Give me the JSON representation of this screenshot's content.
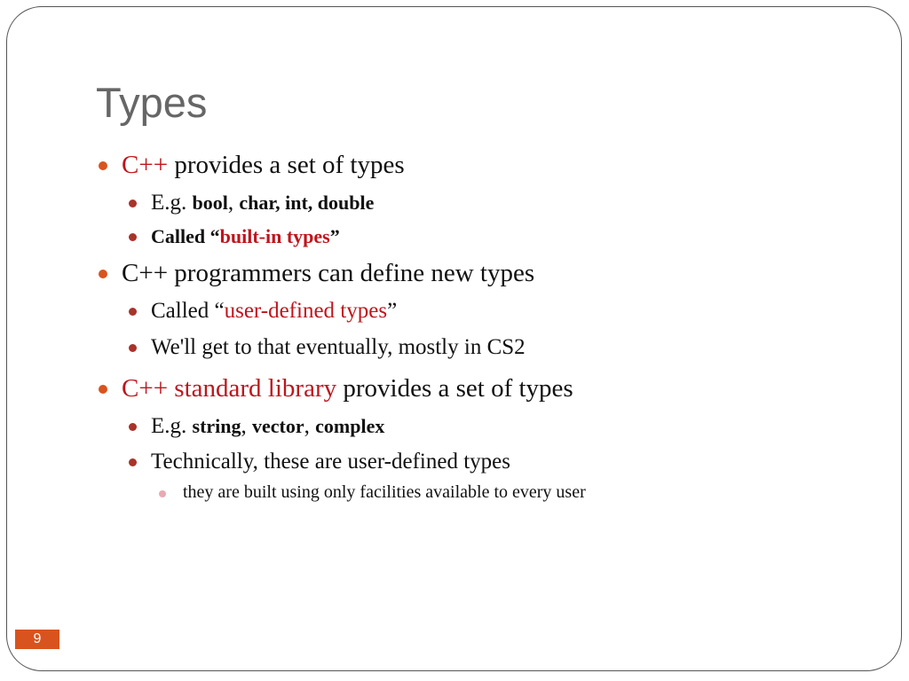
{
  "slide": {
    "title": "Types",
    "page_number": "9",
    "colors": {
      "accent": "#d9531e",
      "highlight": "#c0141c",
      "title": "#666666"
    },
    "bullets": [
      {
        "level": 1,
        "runs": [
          {
            "text": "C++",
            "style": "red"
          },
          {
            "text": " provides a set of types",
            "style": "normal"
          }
        ]
      },
      {
        "level": 2,
        "runs": [
          {
            "text": "E.g. ",
            "style": "normal"
          },
          {
            "text": "bool",
            "style": "bold"
          },
          {
            "text": ", ",
            "style": "normal"
          },
          {
            "text": "char, int, double",
            "style": "bold"
          }
        ]
      },
      {
        "level": 2,
        "runs": [
          {
            "text": "Called “",
            "style": "bold"
          },
          {
            "text": "built-in types",
            "style": "bold-red"
          },
          {
            "text": "”",
            "style": "bold"
          }
        ]
      },
      {
        "level": 1,
        "runs": [
          {
            "text": "C++ programmers can define new types",
            "style": "normal"
          }
        ]
      },
      {
        "level": 2,
        "runs": [
          {
            "text": "Called “",
            "style": "normal"
          },
          {
            "text": "user-defined types",
            "style": "red"
          },
          {
            "text": "”",
            "style": "normal"
          }
        ]
      },
      {
        "level": 2,
        "runs": [
          {
            "text": "We'll get to that eventually, mostly in CS2",
            "style": "normal"
          }
        ]
      },
      {
        "level": 1,
        "runs": [
          {
            "text": "C++ standard library",
            "style": "red"
          },
          {
            "text": " provides a set of types",
            "style": "normal"
          }
        ]
      },
      {
        "level": 2,
        "runs": [
          {
            "text": "E.g. ",
            "style": "normal"
          },
          {
            "text": "string",
            "style": "bold"
          },
          {
            "text": ", ",
            "style": "normal"
          },
          {
            "text": "vector",
            "style": "bold"
          },
          {
            "text": ", ",
            "style": "normal"
          },
          {
            "text": "complex",
            "style": "bold"
          }
        ]
      },
      {
        "level": 2,
        "runs": [
          {
            "text": "Technically, these are user-defined types",
            "style": "normal"
          }
        ]
      },
      {
        "level": 3,
        "runs": [
          {
            "text": "they are built using only facilities available to every user",
            "style": "normal"
          }
        ]
      }
    ]
  }
}
